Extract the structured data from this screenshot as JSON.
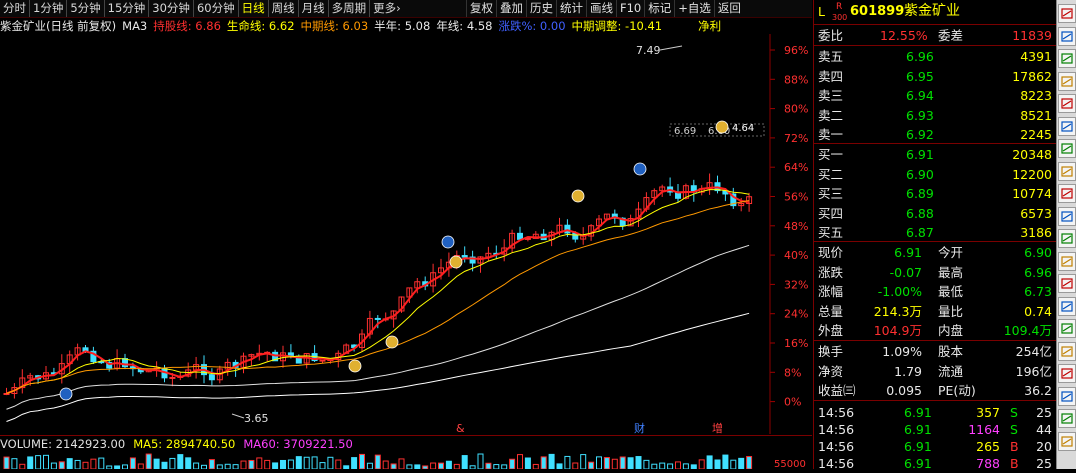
{
  "toolbar": {
    "periods": [
      "分时",
      "1分钟",
      "5分钟",
      "15分钟",
      "30分钟",
      "60分钟",
      "日线",
      "周线",
      "月线",
      "多周期",
      "更多"
    ],
    "selected_period": "日线",
    "more_arrow": "›",
    "actions": [
      "复权",
      "叠加",
      "历史",
      "统计",
      "画线",
      "F10",
      "标记",
      "+自选",
      "返回"
    ]
  },
  "legend": {
    "title": "紫金矿业(日线 前复权)",
    "ma_label": "MA3",
    "items": [
      {
        "label": "持股线: 6.86",
        "color": "#ff3030"
      },
      {
        "label": "生命线: 6.62",
        "color": "#ffff00"
      },
      {
        "label": "中期线: 6.03",
        "color": "#ff9900"
      },
      {
        "label": "半年: 5.08",
        "color": "#e8e8e8"
      },
      {
        "label": "年线: 4.58",
        "color": "#e8e8e8"
      },
      {
        "label": "涨跌%: 0.00",
        "color": "#4060ff"
      },
      {
        "label": "中期调整: -10.41",
        "color": "#ffff00"
      }
    ],
    "jingli": "净利",
    "jingli_color": "#ffff00"
  },
  "chart": {
    "percent_ticks": [
      "96%",
      "88%",
      "80%",
      "72%",
      "64%",
      "56%",
      "48%",
      "40%",
      "32%",
      "24%",
      "16%",
      "8%",
      "0%"
    ],
    "annotations": {
      "high": "7.49",
      "low": "3.65",
      "range_left": "6.69",
      "range_right": "6.60",
      "last_price": "4.64"
    },
    "event_markers": [
      "&",
      "财",
      "增"
    ],
    "right_small_value": "55000"
  },
  "volume_legend": {
    "volume": "VOLUME: 2142923.00",
    "ma5": "MA5: 2894740.50",
    "ma60": "MA60: 3709221.50"
  },
  "quote": {
    "level_badge": "L",
    "r_badge": "R",
    "r_sub": "300",
    "code": "601899",
    "name": "紫金矿业",
    "weibi_label": "委比",
    "weibi_value": "12.55%",
    "weicha_label": "委差",
    "weicha_value": "11839",
    "asks": [
      {
        "label": "卖五",
        "price": "6.96",
        "vol": "4391"
      },
      {
        "label": "卖四",
        "price": "6.95",
        "vol": "17862"
      },
      {
        "label": "卖三",
        "price": "6.94",
        "vol": "8223"
      },
      {
        "label": "卖二",
        "price": "6.93",
        "vol": "8521"
      },
      {
        "label": "卖一",
        "price": "6.92",
        "vol": "2245"
      }
    ],
    "bids": [
      {
        "label": "买一",
        "price": "6.91",
        "vol": "20348"
      },
      {
        "label": "买二",
        "price": "6.90",
        "vol": "12200"
      },
      {
        "label": "买三",
        "price": "6.89",
        "vol": "10774"
      },
      {
        "label": "买四",
        "price": "6.88",
        "vol": "6573"
      },
      {
        "label": "买五",
        "price": "6.87",
        "vol": "3186"
      }
    ],
    "stats": [
      {
        "l1": "现价",
        "v1": "6.91",
        "c1": "#00e000",
        "l2": "今开",
        "v2": "6.90",
        "c2": "#00e000"
      },
      {
        "l1": "涨跌",
        "v1": "-0.07",
        "c1": "#00e000",
        "l2": "最高",
        "v2": "6.96",
        "c2": "#00e000"
      },
      {
        "l1": "涨幅",
        "v1": "-1.00%",
        "c1": "#00e000",
        "l2": "最低",
        "v2": "6.73",
        "c2": "#00e000"
      },
      {
        "l1": "总量",
        "v1": "214.3万",
        "c1": "#ffff00",
        "l2": "量比",
        "v2": "0.74",
        "c2": "#ffff00"
      },
      {
        "l1": "外盘",
        "v1": "104.9万",
        "c1": "#ff3030",
        "l2": "内盘",
        "v2": "109.4万",
        "c2": "#00e000"
      }
    ],
    "fund": [
      {
        "l1": "换手",
        "v1": "1.09%",
        "l2": "股本",
        "v2": "254亿"
      },
      {
        "l1": "净资",
        "v1": "1.79",
        "l2": "流通",
        "v2": "196亿"
      },
      {
        "l1": "收益㈢",
        "v1": "0.095",
        "l2": "PE(动)",
        "v2": "36.2"
      }
    ],
    "ticks": [
      {
        "time": "14:56",
        "price": "6.91",
        "vol": "357",
        "side": "S",
        "n": "25",
        "vcolor": "#ffff00",
        "scolor": "#00e000"
      },
      {
        "time": "14:56",
        "price": "6.91",
        "vol": "1164",
        "side": "S",
        "n": "44",
        "vcolor": "#ff40ff",
        "scolor": "#00e000"
      },
      {
        "time": "14:56",
        "price": "6.91",
        "vol": "265",
        "side": "B",
        "n": "20",
        "vcolor": "#ffff00",
        "scolor": "#ff3030"
      },
      {
        "time": "14:56",
        "price": "6.91",
        "vol": "788",
        "side": "B",
        "n": "25",
        "vcolor": "#ff40ff",
        "scolor": "#ff3030"
      }
    ]
  },
  "side_icons": [
    "chart-icon",
    "table-icon",
    "list-icon",
    "transaction-icon",
    "info-icon",
    "quote-icon",
    "minute-icon",
    "kline-icon",
    "compare-icon",
    "news-icon",
    "finance-icon",
    "trend-icon",
    "hot-icon",
    "rank-icon",
    "index-icon",
    "flow-icon",
    "fund-icon",
    "dde-icon",
    "rsi-icon",
    "more-icon"
  ]
}
